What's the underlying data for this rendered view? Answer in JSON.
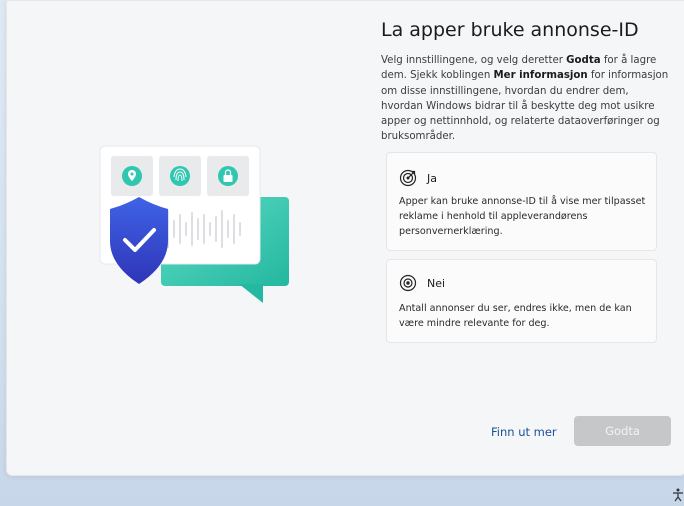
{
  "page": {
    "title": "La apper bruke annonse-ID",
    "description": {
      "part1": "Velg innstillingene, og velg deretter ",
      "bold1": "Godta",
      "part2": " for å lagre dem. Sjekk koblingen ",
      "bold2": "Mer informasjon",
      "part3": " for informasjon om disse innstillingene, hvordan du endrer dem, hvordan Windows bidrar til å beskytte deg mot usikre apper og nettinnhold, og relaterte dataoverføringer og bruksområder."
    }
  },
  "options": [
    {
      "label": "Ja",
      "icon": "target-icon",
      "text": "Apper kan bruke annonse-ID til å vise mer tilpasset reklame i henhold til appleverandørens personvernerklæring."
    },
    {
      "label": "Nei",
      "icon": "radio-circle-icon",
      "text": "Antall annonser du ser, endres ikke, men de kan være mindre relevante for deg."
    }
  ],
  "footer": {
    "learn_more": "Finn ut mer",
    "accept": "Godta"
  },
  "colors": {
    "accent_link": "#1a4f9c",
    "shield": "#3b53d6",
    "teal": "#2fc7b0",
    "button_disabled": "#c5c7c9"
  }
}
